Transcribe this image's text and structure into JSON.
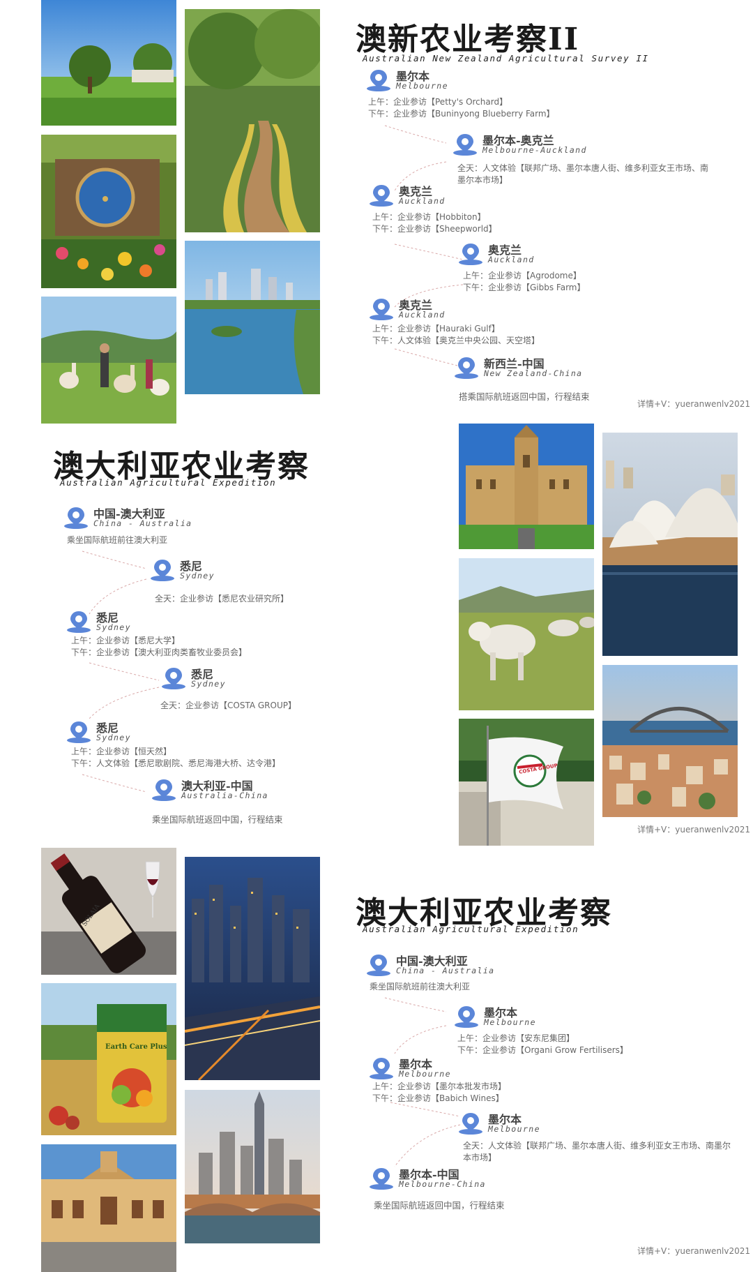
{
  "sections": [
    {
      "title": "澳新农业考察II",
      "subtitle": "Australian New Zealand Agricultural Survey II",
      "stops": [
        {
          "name": "墨尔本",
          "en": "Melbourne",
          "lines": [
            "上午：企业参访【Petty's Orchard】",
            "下午：企业参访【Buninyong Blueberry Farm】"
          ]
        },
        {
          "name": "墨尔本-奥克兰",
          "en": "Melbourne-Auckland",
          "lines": [
            "全天：人文体验【联邦广场、墨尔本唐人街、维多利亚女王市场、南墨尔本市场】"
          ]
        },
        {
          "name": "奥克兰",
          "en": "Auckland",
          "lines": [
            "上午：企业参访【Hobbiton】",
            "下午：企业参访【Sheepworld】"
          ]
        },
        {
          "name": "奥克兰",
          "en": "Auckland",
          "lines": [
            "上午：企业参访【Agrodome】",
            "下午：企业参访【Gibbs Farm】"
          ]
        },
        {
          "name": "奥克兰",
          "en": "Auckland",
          "lines": [
            "上午：企业参访【Hauraki Gulf】",
            "下午：人文体验【奥克兰中央公园、天空塔】"
          ]
        },
        {
          "name": "新西兰-中国",
          "en": "New Zealand-China",
          "lines": []
        }
      ],
      "closing": "搭乘国际航班返回中国，行程结束",
      "contact": "详情+V：yueranwenlv2021"
    },
    {
      "title": "澳大利亚农业考察",
      "subtitle": "Australian Agricultural Expedition",
      "stops": [
        {
          "name": "中国-澳大利亚",
          "en": "China - Australia",
          "lines": [
            "乘坐国际航班前往澳大利亚"
          ]
        },
        {
          "name": "悉尼",
          "en": "Sydney",
          "lines": [
            "全天：企业参访【悉尼农业研究所】"
          ]
        },
        {
          "name": "悉尼",
          "en": "Sydney",
          "lines": [
            "上午：企业参访【悉尼大学】",
            "下午：企业参访【澳大利亚肉类畜牧业委员会】"
          ]
        },
        {
          "name": "悉尼",
          "en": "Sydney",
          "lines": [
            "全天：企业参访【COSTA GROUP】"
          ]
        },
        {
          "name": "悉尼",
          "en": "Sydney",
          "lines": [
            "上午：企业参访【恒天然】",
            "下午：人文体验【悉尼歌剧院、悉尼海港大桥、达令港】"
          ]
        },
        {
          "name": "澳大利亚-中国",
          "en": "Australia-China",
          "lines": []
        }
      ],
      "closing": "乘坐国际航班返回中国，行程结束",
      "contact": "详情+V：yueranwenlv2021"
    },
    {
      "title": "澳大利亚农业考察",
      "subtitle": "Australian Agricultural Expedition",
      "stops": [
        {
          "name": "中国-澳大利亚",
          "en": "China - Australia",
          "lines": [
            "乘坐国际航班前往澳大利亚"
          ]
        },
        {
          "name": "墨尔本",
          "en": "Melbourne",
          "lines": [
            "上午：企业参访【安东尼集团】",
            "下午：企业参访【Organi Grow Fertilisers】"
          ]
        },
        {
          "name": "墨尔本",
          "en": "Melbourne",
          "lines": [
            "上午：企业参访【墨尔本批发市场】",
            "下午：企业参访【Babich Wines】"
          ]
        },
        {
          "name": "墨尔本",
          "en": "Melbourne",
          "lines": [
            "全天：人文体验【联邦广场、墨尔本唐人街、维多利亚女王市场、南墨尔本市场】"
          ]
        },
        {
          "name": "墨尔本-中国",
          "en": "Melbourne-China",
          "lines": []
        }
      ],
      "closing": "乘坐国际航班返回中国，行程结束",
      "contact": "详情+V：yueranwenlv2021"
    }
  ],
  "photo_labels": {
    "costa_flag": "COSTA GROUP",
    "wine_label": "SOLAIA",
    "fertilizer_label": "Earth Care Plus"
  },
  "colors": {
    "pin": "#5b86d8",
    "title": "#1a1a1a",
    "text": "#666666",
    "connector": "#d9a8a8"
  }
}
